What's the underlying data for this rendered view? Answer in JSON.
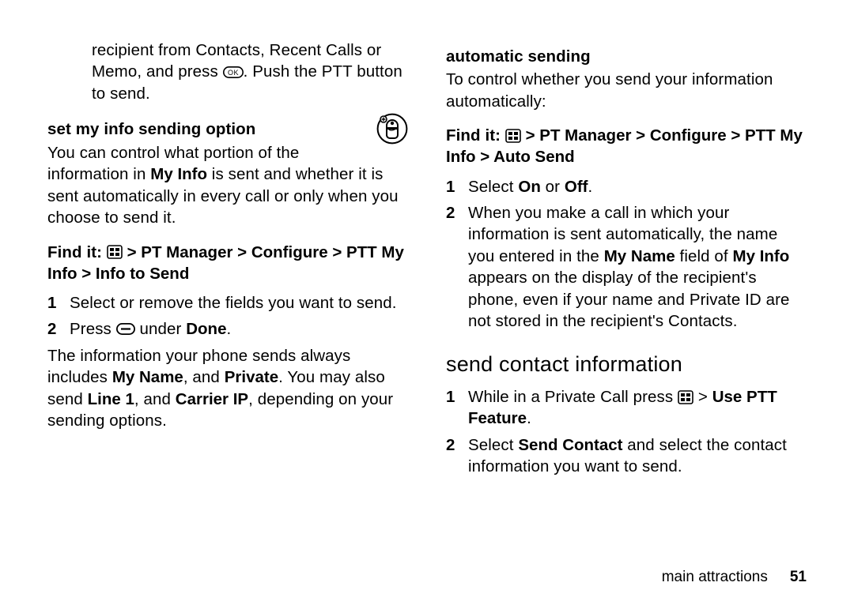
{
  "left": {
    "intro": "recipient from Contacts, Recent Calls or Memo, and press ",
    "intro2": ". Push the PTT button to send.",
    "h_setmyinfo": "set my info sending option",
    "p_setmyinfo_a": "You can control what portion of the information in ",
    "cond_myinfo": "My Info",
    "p_setmyinfo_b": " is sent and whether it is sent automatically in every call or only when you choose to send it.",
    "findit_label": "Find it: ",
    "findit_path": " > PT Manager > Configure > PTT My Info > Info to Send",
    "step1": "Select or remove the fields you want to send.",
    "step2_a": "Press ",
    "step2_b": " under ",
    "cond_done": "Done",
    "step2_c": ".",
    "p_after_a": "The information your phone sends always includes ",
    "cond_myname": "My Name",
    "p_after_b": ", and ",
    "cond_private": "Private",
    "p_after_c": ". You may also send ",
    "cond_line1": "Line 1",
    "p_after_d": ", and ",
    "cond_carrierip": "Carrier IP",
    "p_after_e": ", depending on your sending options."
  },
  "right": {
    "h_auto": "automatic sending",
    "p_auto": "To control whether you send your information automatically:",
    "findit_label": "Find it: ",
    "findit_path": " > PT Manager > Configure > PTT My Info > Auto Send",
    "step1_a": "Select ",
    "cond_on": "On",
    "step1_b": " or ",
    "cond_off": "Off",
    "step1_c": ".",
    "step2_a": "When you make a call in which your information is sent automatically, the name you entered in the ",
    "cond_myname": "My Name",
    "step2_b": " field of ",
    "cond_myinfo": "My Info",
    "step2_c": " appears on the display of the recipient's phone, even if your name and Private ID are not stored in the recipient's Contacts.",
    "h_sendcontact": "send contact information",
    "sc_step1_a": "While in a Private Call press ",
    "sc_step1_b": " > ",
    "cond_useptt": "Use PTT Feature",
    "sc_step1_c": ".",
    "sc_step2_a": "Select ",
    "cond_sendcontact": "Send Contact",
    "sc_step2_b": " and select the contact information you want to send."
  },
  "footer": {
    "section": "main attractions",
    "page": "51"
  }
}
